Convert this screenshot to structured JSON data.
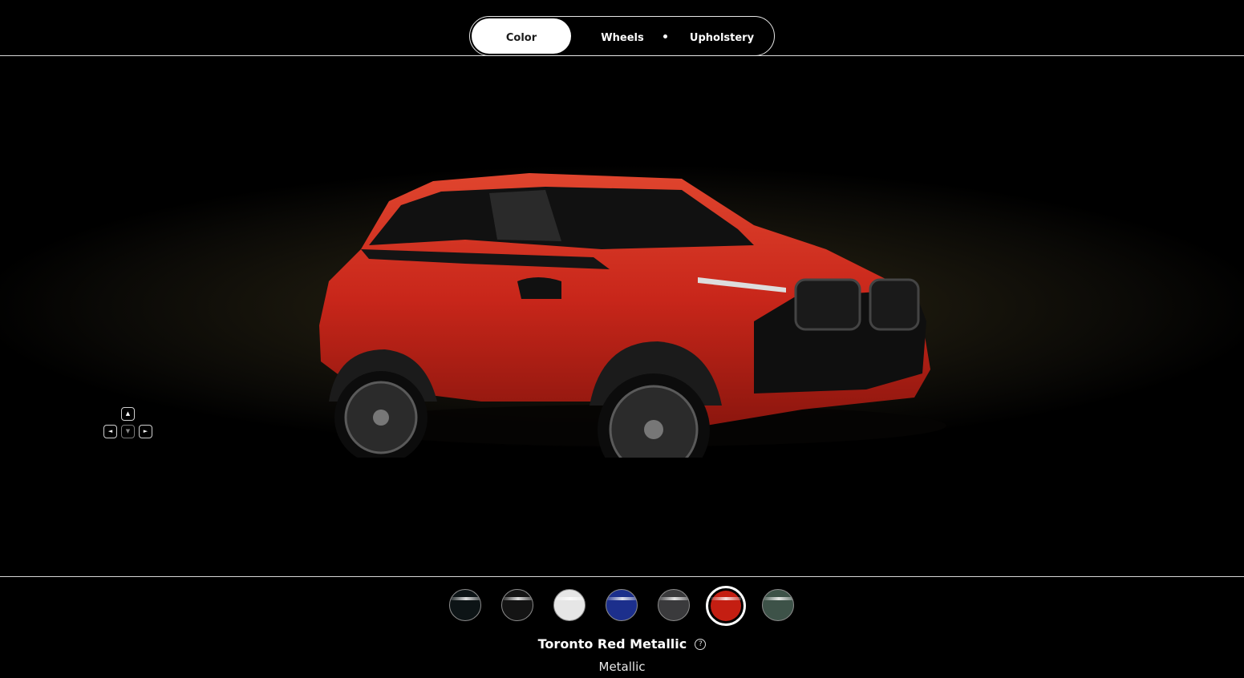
{
  "tabs": [
    {
      "label": "Color",
      "active": true
    },
    {
      "label": "Wheels",
      "active": false
    },
    {
      "label": "Upholstery",
      "active": false
    }
  ],
  "viewer": {
    "nav": {
      "up": "▲",
      "left": "◄",
      "down": "▼",
      "right": "►"
    },
    "car_color": "#c8261a"
  },
  "swatches": [
    {
      "color": "#0d1416",
      "selected": false
    },
    {
      "color": "#141414",
      "selected": false
    },
    {
      "color": "#e6e6e6",
      "selected": false
    },
    {
      "color": "#1c2f8c",
      "selected": false
    },
    {
      "color": "#3a3a3c",
      "selected": false
    },
    {
      "color": "#c41e12",
      "selected": true
    },
    {
      "color": "#3d5248",
      "selected": false
    }
  ],
  "selected_color": {
    "name": "Toronto Red Metallic",
    "help_icon": "?",
    "type": "Metallic"
  }
}
